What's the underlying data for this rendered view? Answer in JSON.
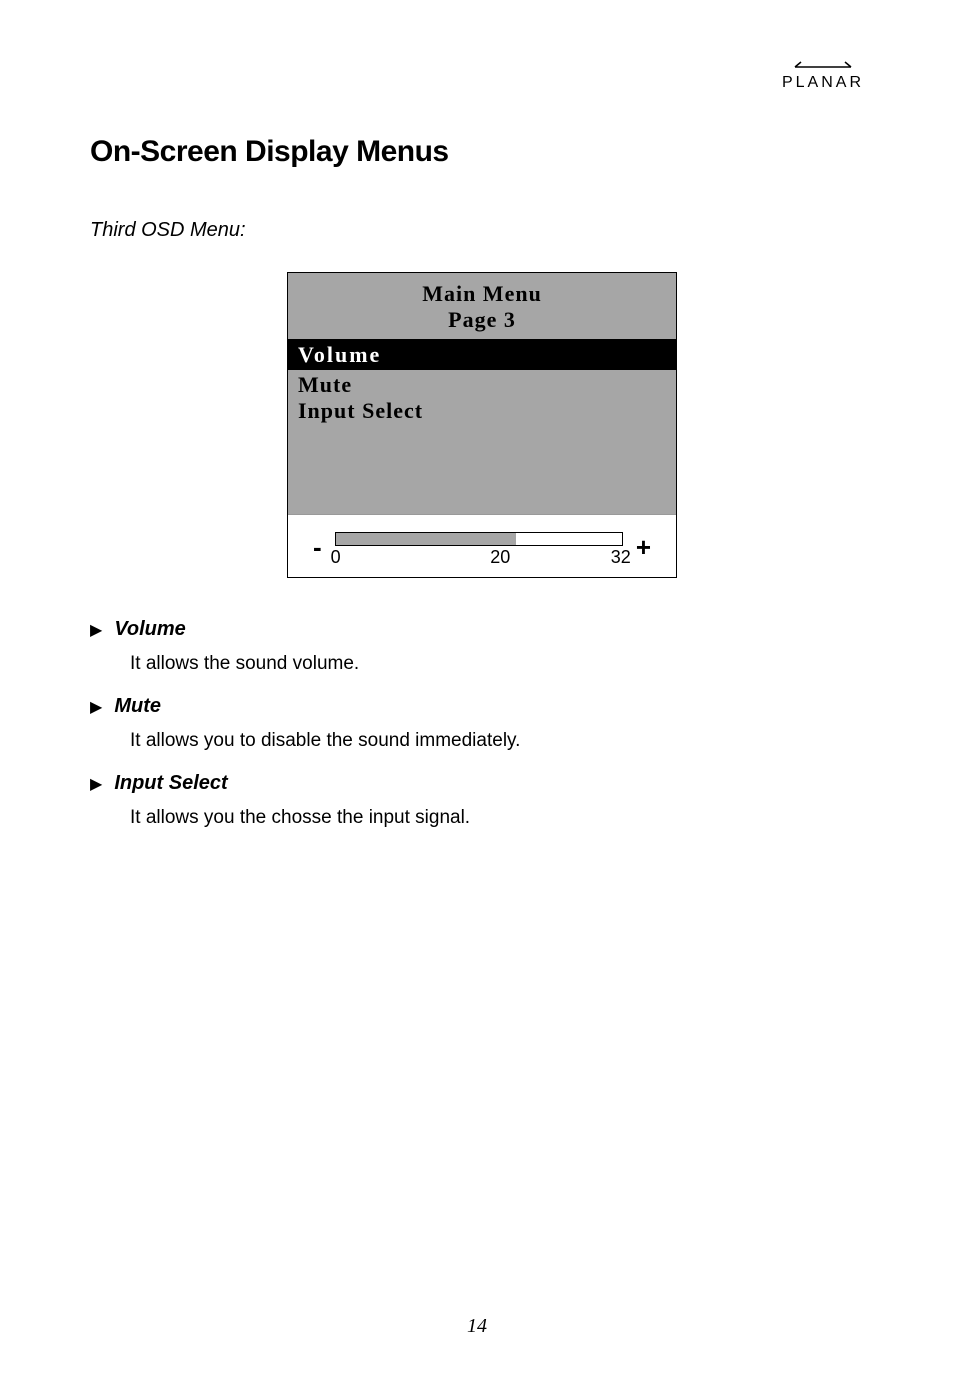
{
  "logo": {
    "text": "PLANAR"
  },
  "heading": "On-Screen Display Menus",
  "subheading": "Third OSD Menu:",
  "osd": {
    "header_line1": "Main Menu",
    "header_line2": "Page 3",
    "selected": "Volume",
    "items": [
      "Mute",
      "Input Select"
    ],
    "slider": {
      "min": "0",
      "current": "20",
      "max": "32"
    }
  },
  "definitions": [
    {
      "title": "Volume",
      "desc": "It allows the sound volume."
    },
    {
      "title": "Mute",
      "desc": "It allows you to disable the sound immediately."
    },
    {
      "title": "Input Select",
      "desc": "It allows you the chosse the input signal."
    }
  ],
  "page_number": "14"
}
